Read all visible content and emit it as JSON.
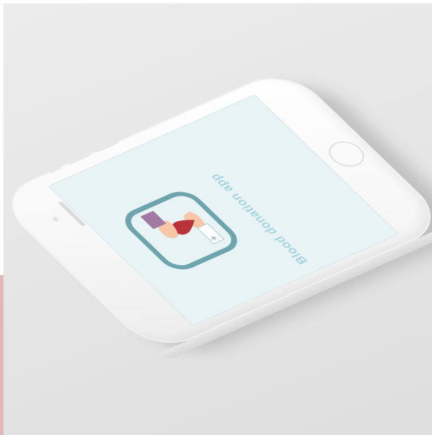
{
  "app": {
    "title": "Blood donation app"
  },
  "colors": {
    "background": "#e6e6e6",
    "screen": "#e8f3f5",
    "icon_border": "#6ea4ae",
    "title_text": "#a8d4e2",
    "blood_drop": "#b8323a",
    "accent_strip": "#e2b7b5"
  },
  "icons": {
    "app_icon": "hand-giving-blood-drop-icon",
    "home_button": "home-button-icon"
  }
}
